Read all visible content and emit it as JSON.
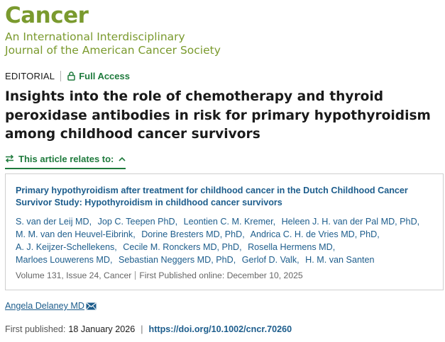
{
  "journal": {
    "name": "Cancer",
    "subtitle_line1": "An International Interdisciplinary",
    "subtitle_line2": "Journal of the American Cancer Society",
    "brand_color": "#7a9a2e"
  },
  "article": {
    "type": "EDITORIAL",
    "access": "Full Access",
    "title": "Insights into the role of chemotherapy and thyroid peroxidase antibodies in risk for primary hypothyroidism among childhood cancer survivors",
    "relates_label": "This article relates to:",
    "author": "Angela Delaney MD",
    "first_published_label": "First published:",
    "first_published_date": "18 January 2026",
    "doi": "https://doi.org/10.1002/cncr.70260"
  },
  "related": {
    "title": "Primary hypothyroidism after treatment for childhood cancer in the Dutch Childhood Cancer Survivor Study: Hypothyroidism in childhood cancer survivors",
    "authors": [
      "S. van der Leij MD",
      "Jop C. Teepen PhD",
      "Leontien C. M. Kremer",
      "Heleen J. H. van der Pal MD, PhD",
      "M. M. van den Heuvel-Eibrink",
      "Dorine Bresters MD, PhD",
      "Andrica C. H. de Vries MD, PhD",
      "A. J. Keijzer-Schellekens",
      "Cecile M. Ronckers MD, PhD",
      "Rosella Hermens MD",
      "Marloes Louwerens MD",
      "Sebastian Neggers MD, PhD",
      "Gerlof D. Valk",
      "H. M. van Santen"
    ],
    "volume": "Volume 131",
    "issue": "Issue 24",
    "journal": "Cancer",
    "published": "First Published online: December 10, 2025"
  },
  "colors": {
    "access_green": "#1e7a3c",
    "link_blue": "#1d5d8c"
  },
  "icons": [
    "lock-icon",
    "swap-arrows-icon",
    "chevron-up-icon",
    "envelope-icon"
  ]
}
